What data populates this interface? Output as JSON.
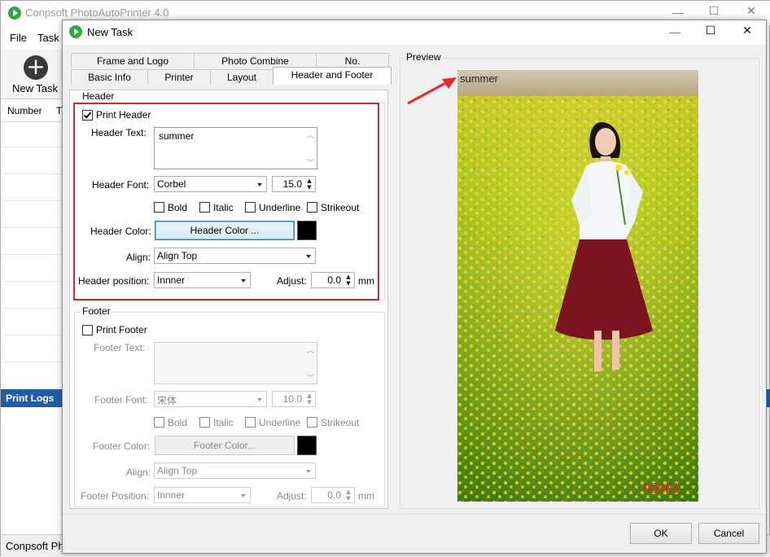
{
  "main_window": {
    "title": "Conpsoft PhotoAutoPrinter 4.0",
    "menu": [
      "File",
      "Task"
    ],
    "toolbar_new_task": "New Task",
    "grid_columns": [
      "Number",
      "T"
    ],
    "print_logs_label": "Print Logs",
    "status_text": "Conpsoft Ph"
  },
  "dialog": {
    "title": "New Task",
    "tabs_row1": [
      "Frame and Logo",
      "Photo Combine",
      "No."
    ],
    "tabs_row2": [
      "Basic Info",
      "Printer",
      "Layout",
      "Header and Footer"
    ],
    "active_tab": "Header and Footer",
    "header": {
      "group_title": "Header",
      "print_header_label": "Print Header",
      "print_header_checked": true,
      "text_label": "Header Text:",
      "text_value": "summer",
      "font_label": "Header Font:",
      "font_value": "Corbel",
      "font_size": "15.0",
      "styles": [
        "Bold",
        "Italic",
        "Underline",
        "Strikeout"
      ],
      "color_label": "Header Color:",
      "color_button": "Header Color ...",
      "color_value": "#000000",
      "align_label": "Align:",
      "align_value": "Align Top",
      "position_label": "Header position:",
      "position_value": "Innner",
      "adjust_label": "Adjust:",
      "adjust_value": "0.0",
      "unit": "mm"
    },
    "footer": {
      "group_title": "Footer",
      "print_footer_label": "Print Footer",
      "print_footer_checked": false,
      "text_label": "Footer Text:",
      "text_value": "",
      "font_label": "Footer Font:",
      "font_value": "宋体",
      "font_size": "10.0",
      "styles": [
        "Bold",
        "Italic",
        "Underline",
        "Strikeout"
      ],
      "color_label": "Footer Color:",
      "color_button": "Footer Color...",
      "color_value": "#000000",
      "align_label": "Align:",
      "align_value": "Align Top",
      "position_label": "Footer Position:",
      "position_value": "Innner",
      "adjust_label": "Adjust:",
      "adjust_value": "0.0",
      "unit": "mm"
    },
    "preview": {
      "group_title": "Preview",
      "header_text": "summer",
      "number_text": "00001",
      "number_color": "#e0201a",
      "annotation_arrow_color": "#e8262d"
    },
    "buttons": {
      "ok": "OK",
      "cancel": "Cancel"
    }
  }
}
